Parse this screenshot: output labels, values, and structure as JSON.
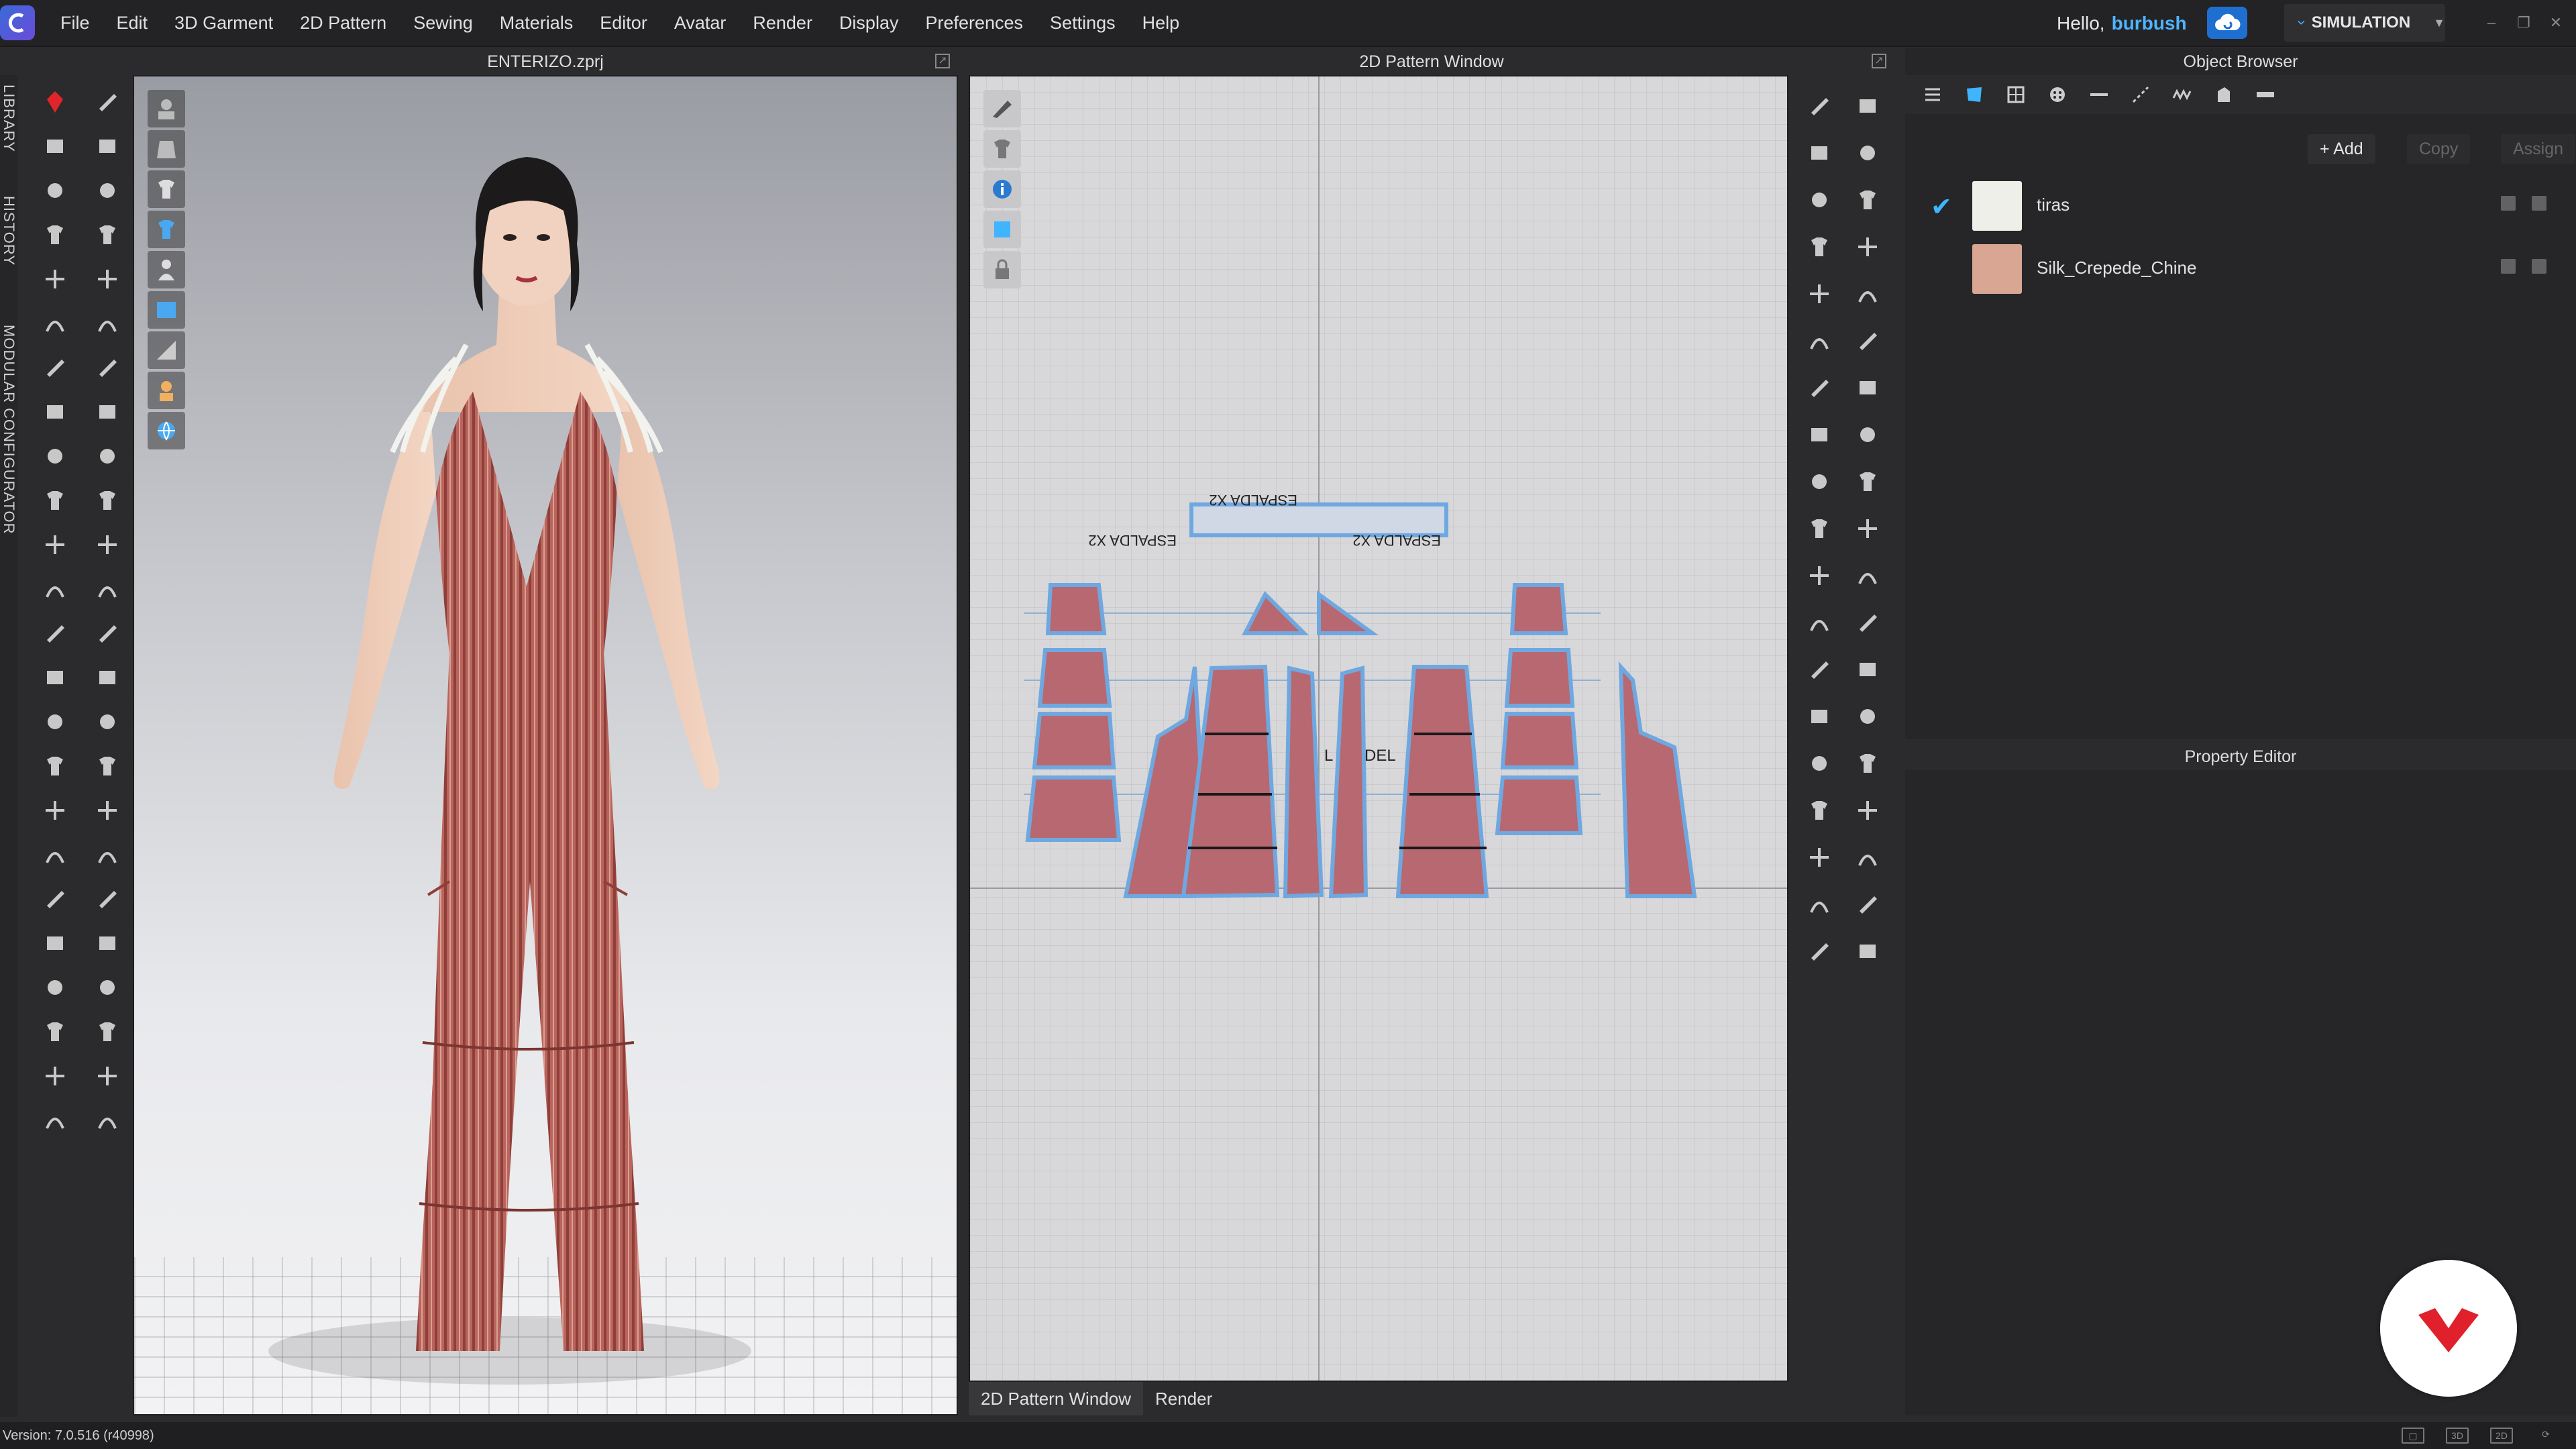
{
  "menubar": {
    "items": [
      "File",
      "Edit",
      "3D Garment",
      "2D Pattern",
      "Sewing",
      "Materials",
      "Editor",
      "Avatar",
      "Render",
      "Display",
      "Preferences",
      "Settings",
      "Help"
    ],
    "greeting": "Hello,",
    "username": "burbush",
    "mode": "SIMULATION"
  },
  "viewport3d": {
    "title": "ENTERIZO.zprj"
  },
  "pattern_window": {
    "title": "2D Pattern Window",
    "labels": [
      "ESPALDA X2",
      "ESPALDA X2",
      "ESPALDA X2"
    ],
    "piece_marks": [
      "L",
      "DEL"
    ]
  },
  "left_tabs": [
    "LIBRARY",
    "HISTORY",
    "MODULAR CONFIGURATOR"
  ],
  "bottom_tabs": [
    "2D Pattern Window",
    "Render"
  ],
  "object_browser": {
    "title": "Object Browser",
    "actions": {
      "add": "+ Add",
      "copy": "Copy",
      "assign": "Assign"
    },
    "materials": [
      {
        "name": "tiras",
        "color": "#efefea",
        "selected": true
      },
      {
        "name": "Silk_Crepede_Chine",
        "color": "#d8a692",
        "selected": false
      }
    ]
  },
  "property_editor": {
    "title": "Property Editor"
  },
  "statusbar": {
    "version": "Version: 7.0.516 (r40998)"
  },
  "colors": {
    "accent": "#3fb5ff",
    "fabric": "#b5645c",
    "pattern_piece": "#b86870",
    "pattern_outline": "#6fa8e0"
  }
}
